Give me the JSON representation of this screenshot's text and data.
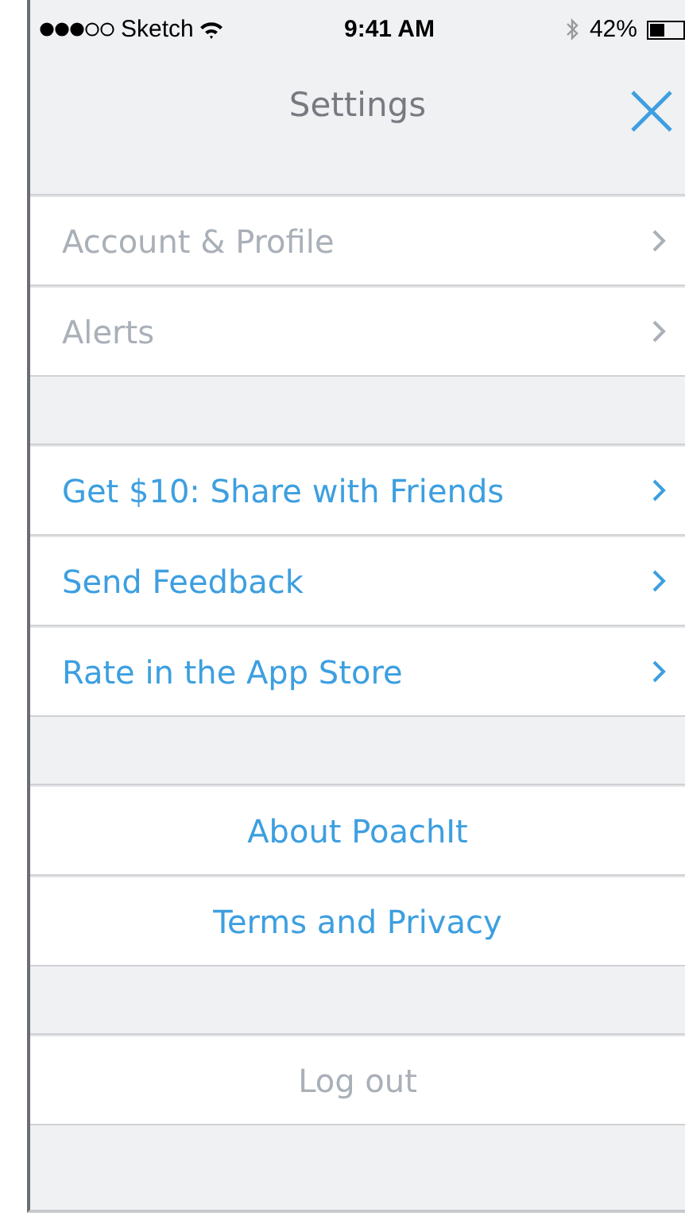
{
  "status_bar": {
    "carrier": "Sketch",
    "time": "9:41 AM",
    "battery": "42%"
  },
  "nav_bar": {
    "title": "Settings"
  },
  "sections": [
    {
      "rows": [
        {
          "label": "Account & Profile",
          "kind": "link",
          "disabled": true
        },
        {
          "label": "Alerts",
          "kind": "link",
          "disabled": true
        }
      ]
    },
    {
      "rows": [
        {
          "label": "Get $10: Share with Friends",
          "kind": "link",
          "disabled": false
        },
        {
          "label": "Send Feedback",
          "kind": "link",
          "disabled": false
        },
        {
          "label": "Rate in the App Store",
          "kind": "link",
          "disabled": false
        }
      ]
    },
    {
      "rows": [
        {
          "label": "About PoachIt",
          "kind": "center",
          "disabled": false
        },
        {
          "label": "Terms and Privacy",
          "kind": "center",
          "disabled": false
        }
      ]
    },
    {
      "rows": [
        {
          "label": "Log out",
          "kind": "center",
          "disabled": true
        }
      ]
    }
  ]
}
